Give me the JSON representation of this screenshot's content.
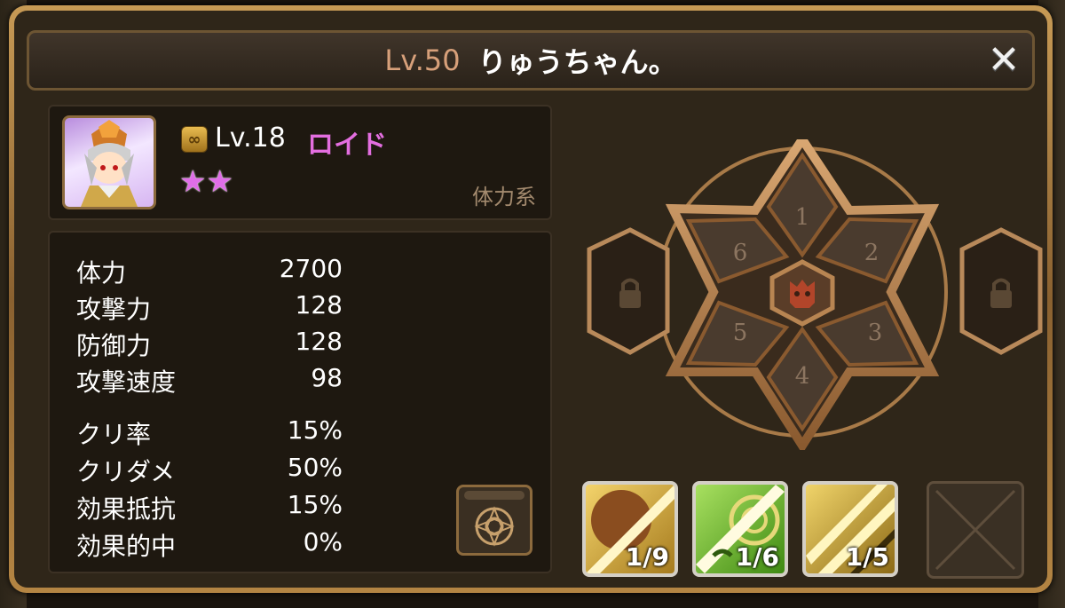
{
  "title": {
    "level": "Lv.50",
    "name": "りゅうちゃん。"
  },
  "close_label": "✕",
  "monster": {
    "level": "Lv.18",
    "name": "ロイド",
    "stars": [
      "★",
      "★"
    ],
    "type": "体力系",
    "rune_icon": "∞"
  },
  "stats": [
    {
      "label": "体力",
      "value": "2700"
    },
    {
      "label": "攻撃力",
      "value": "128"
    },
    {
      "label": "防御力",
      "value": "128"
    },
    {
      "label": "攻撃速度",
      "value": "98"
    },
    {
      "label": "クリ率",
      "value": "15%"
    },
    {
      "label": "クリダメ",
      "value": "50%"
    },
    {
      "label": "効果抵抗",
      "value": "15%"
    },
    {
      "label": "効果的中",
      "value": "0%"
    }
  ],
  "rune_slots": [
    "1",
    "2",
    "3",
    "4",
    "5",
    "6"
  ],
  "skills": [
    {
      "level": "1/9",
      "icon": "sword-skill-icon",
      "color": "#c9a23a"
    },
    {
      "level": "1/6",
      "icon": "wind-skill-icon",
      "color": "#6fbf2a"
    },
    {
      "level": "1/5",
      "icon": "slash-skill-icon",
      "color": "#d8b347"
    }
  ],
  "colors": {
    "accent": "#e36ee0",
    "frame": "#b48543",
    "panel": "#1e1810"
  }
}
